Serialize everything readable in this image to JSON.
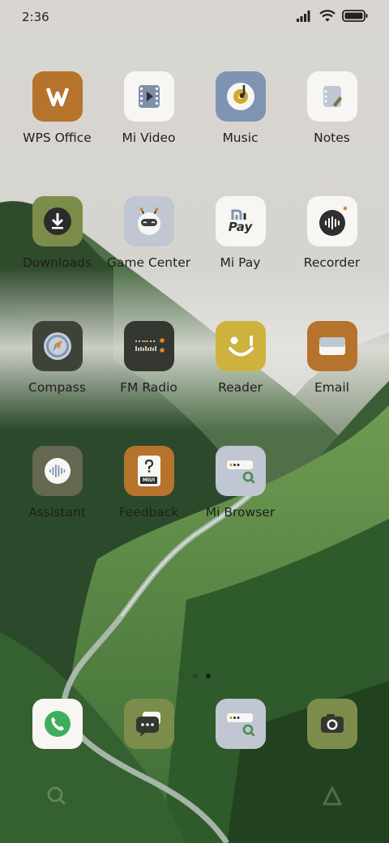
{
  "status": {
    "time": "2:36",
    "icons": [
      "signal-icon",
      "wifi-icon",
      "battery-icon"
    ]
  },
  "apps": [
    {
      "name": "app-wps-office",
      "label": "WPS Office",
      "icon": "wps-office-icon",
      "bg": "#b5732b"
    },
    {
      "name": "app-mi-video",
      "label": "Mi Video",
      "icon": "mi-video-icon",
      "bg": "#f7f6f3"
    },
    {
      "name": "app-music",
      "label": "Music",
      "icon": "music-icon",
      "bg": "#7f94b3"
    },
    {
      "name": "app-notes",
      "label": "Notes",
      "icon": "notes-icon",
      "bg": "#f7f6f3"
    },
    {
      "name": "app-downloads",
      "label": "Downloads",
      "icon": "downloads-icon",
      "bg": "#7c8d4b"
    },
    {
      "name": "app-game-center",
      "label": "Game Center",
      "icon": "game-center-icon",
      "bg": "#c0c6d2"
    },
    {
      "name": "app-mi-pay",
      "label": "Mi Pay",
      "icon": "mi-pay-icon",
      "bg": "#f7f6f3",
      "text": "Pay"
    },
    {
      "name": "app-recorder",
      "label": "Recorder",
      "icon": "recorder-icon",
      "bg": "#f7f6f3"
    },
    {
      "name": "app-compass",
      "label": "Compass",
      "icon": "compass-icon",
      "bg": "#3e4339"
    },
    {
      "name": "app-fm-radio",
      "label": "FM Radio",
      "icon": "fm-radio-icon",
      "bg": "#34372f"
    },
    {
      "name": "app-reader",
      "label": "Reader",
      "icon": "reader-icon",
      "bg": "#cdb23e"
    },
    {
      "name": "app-email",
      "label": "Email",
      "icon": "email-icon",
      "bg": "#b5732b"
    },
    {
      "name": "app-assistant",
      "label": "Assistant",
      "icon": "assistant-icon",
      "bg": "#646850"
    },
    {
      "name": "app-feedback",
      "label": "Feedback",
      "icon": "feedback-icon",
      "bg": "#b5732b",
      "text": "MIUI"
    },
    {
      "name": "app-mi-browser",
      "label": "Mi Browser",
      "icon": "mi-browser-icon",
      "bg": "#c0c6d2"
    }
  ],
  "dock": [
    {
      "name": "dock-phone",
      "icon": "phone-icon",
      "bg": "#f7f6f3"
    },
    {
      "name": "dock-messages",
      "icon": "messages-icon",
      "bg": "#7c8d4b"
    },
    {
      "name": "dock-browser",
      "icon": "mi-browser-icon",
      "bg": "#c0c6d2"
    },
    {
      "name": "dock-camera",
      "icon": "camera-icon",
      "bg": "#7c8d4b"
    }
  ],
  "page_indicator": {
    "pages": 2,
    "active": 2
  }
}
